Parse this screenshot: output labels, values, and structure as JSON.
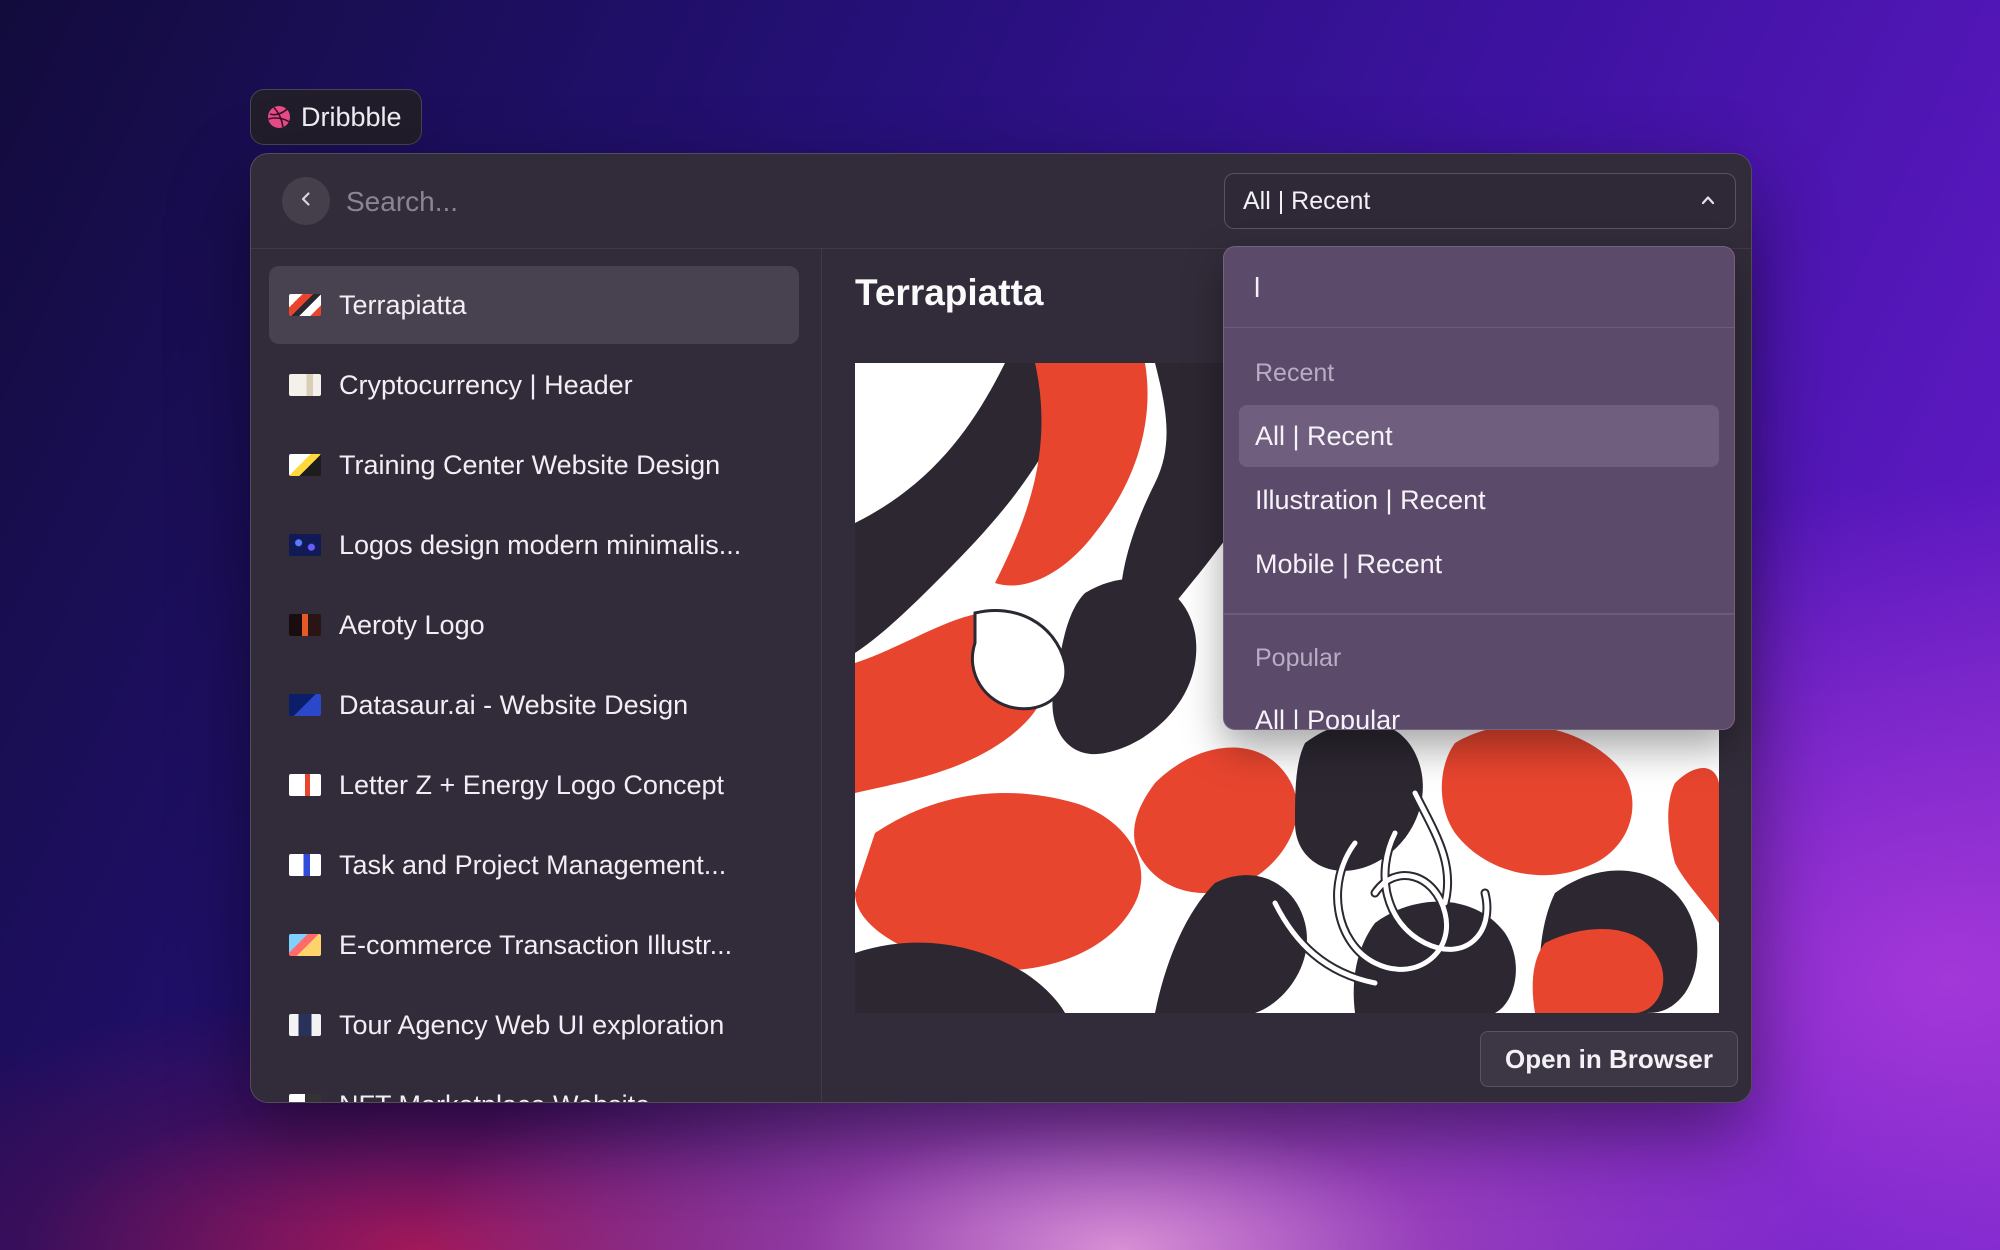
{
  "tab": {
    "label": "Dribbble",
    "icon": "dribbble-icon",
    "icon_color": "#ea4c89"
  },
  "search": {
    "placeholder": "Search...",
    "value": ""
  },
  "filter": {
    "selected": "All | Recent"
  },
  "list": {
    "items": [
      {
        "label": "Terrapiatta",
        "selected": true
      },
      {
        "label": "Cryptocurrency | Header"
      },
      {
        "label": "Training Center Website Design"
      },
      {
        "label": "Logos design modern minimalis..."
      },
      {
        "label": "Aeroty Logo"
      },
      {
        "label": "Datasaur.ai - Website Design"
      },
      {
        "label": "Letter Z + Energy Logo Concept"
      },
      {
        "label": "Task and Project Management..."
      },
      {
        "label": "E-commerce Transaction Illustr..."
      },
      {
        "label": "Tour Agency Web UI exploration"
      },
      {
        "label": "NFT Marketplace Website"
      }
    ]
  },
  "detail": {
    "title": "Terrapiatta",
    "open_button": "Open in Browser"
  },
  "dropdown": {
    "search_value": "l",
    "sections": [
      {
        "header": "Recent",
        "options": [
          "All | Recent",
          "Illustration | Recent",
          "Mobile | Recent"
        ]
      },
      {
        "header": "Popular",
        "options": [
          "All | Popular"
        ]
      }
    ],
    "active_option": "All | Recent"
  },
  "colors": {
    "accent_red": "#e8452f",
    "selected_row": "#48414f",
    "dropdown_bg": "#5b4a6a"
  }
}
